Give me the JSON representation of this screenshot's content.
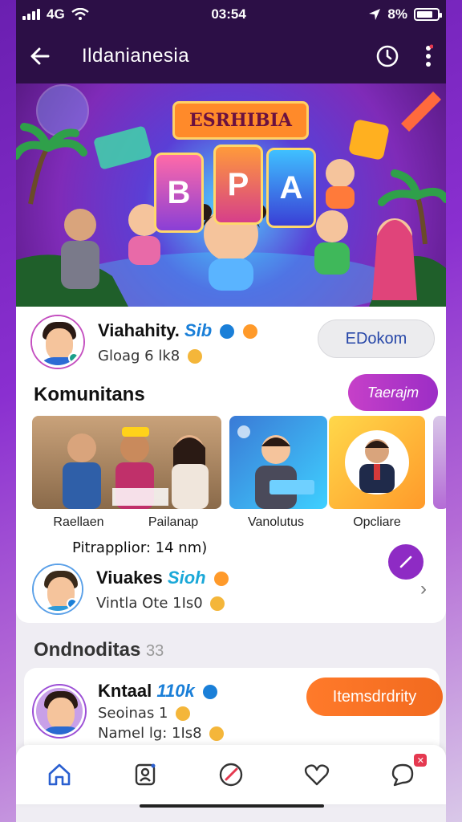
{
  "status": {
    "signal": "4G",
    "time": "03:54",
    "battery": "8%"
  },
  "appbar": {
    "title": "Ildanianesia"
  },
  "banner": {
    "sign": "ESRHIBIA",
    "tiles": [
      "B",
      "P",
      "A"
    ]
  },
  "profile": {
    "name": "Viahahity.",
    "tag": "Sib",
    "sub": "Gloag 6 lk8",
    "button": "EDokom"
  },
  "communities": {
    "title": "Komunitans",
    "button": "Taerajm",
    "items": [
      {
        "label": "Raellaen"
      },
      {
        "label": "Pailanap"
      },
      {
        "label": "Vanolutus"
      },
      {
        "label": "Opcliare"
      }
    ],
    "meta": "Pitrapplior: 14 nm)"
  },
  "member": {
    "name": "Viuakes",
    "tag": "Sioh",
    "sub": "Vintla Ote 1Is0"
  },
  "section2": {
    "title": "Ondnoditas",
    "count": "33"
  },
  "member2": {
    "name": "Kntaal",
    "tag": "110k",
    "line1": "Seoinas 1",
    "line2": "Namel lg: 1Is8",
    "button": "Itemsdrdrity"
  },
  "colors": {
    "appbar": "#2c0f46",
    "accent_purple": "#9c2dc6",
    "accent_orange": "#f26a1f",
    "link_blue": "#1a7fd8"
  }
}
